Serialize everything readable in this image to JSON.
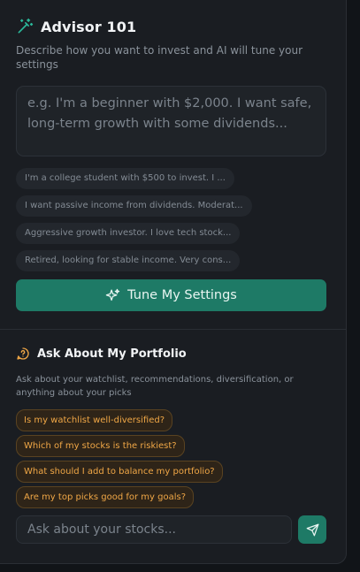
{
  "advisor": {
    "title": "Advisor 101",
    "description": "Describe how you want to invest and AI will tune your settings",
    "input_placeholder": "e.g. I'm a beginner with $2,000. I want safe, long-term growth with some dividends...",
    "examples": [
      "I'm a college student with $500 to invest. I ...",
      "I want passive income from dividends. Moderat...",
      "Aggressive growth investor. I love tech stock...",
      "Retired, looking for stable income. Very cons..."
    ],
    "tune_button": "Tune My Settings",
    "icon": "magic-wand-icon",
    "accent_color": "#1e7a66"
  },
  "portfolio_chat": {
    "title": "Ask About My Portfolio",
    "description": "Ask about your watchlist, recommendations, diversification, or anything about your picks",
    "suggestions": [
      "Is my watchlist well-diversified?",
      "Which of my stocks is the riskiest?",
      "What should I add to balance my portfolio?",
      "Are my top picks good for my goals?"
    ],
    "input_placeholder": "Ask about your stocks...",
    "icon": "chat-question-icon",
    "send_icon": "send-icon",
    "suggestion_color": "#f0a746"
  }
}
